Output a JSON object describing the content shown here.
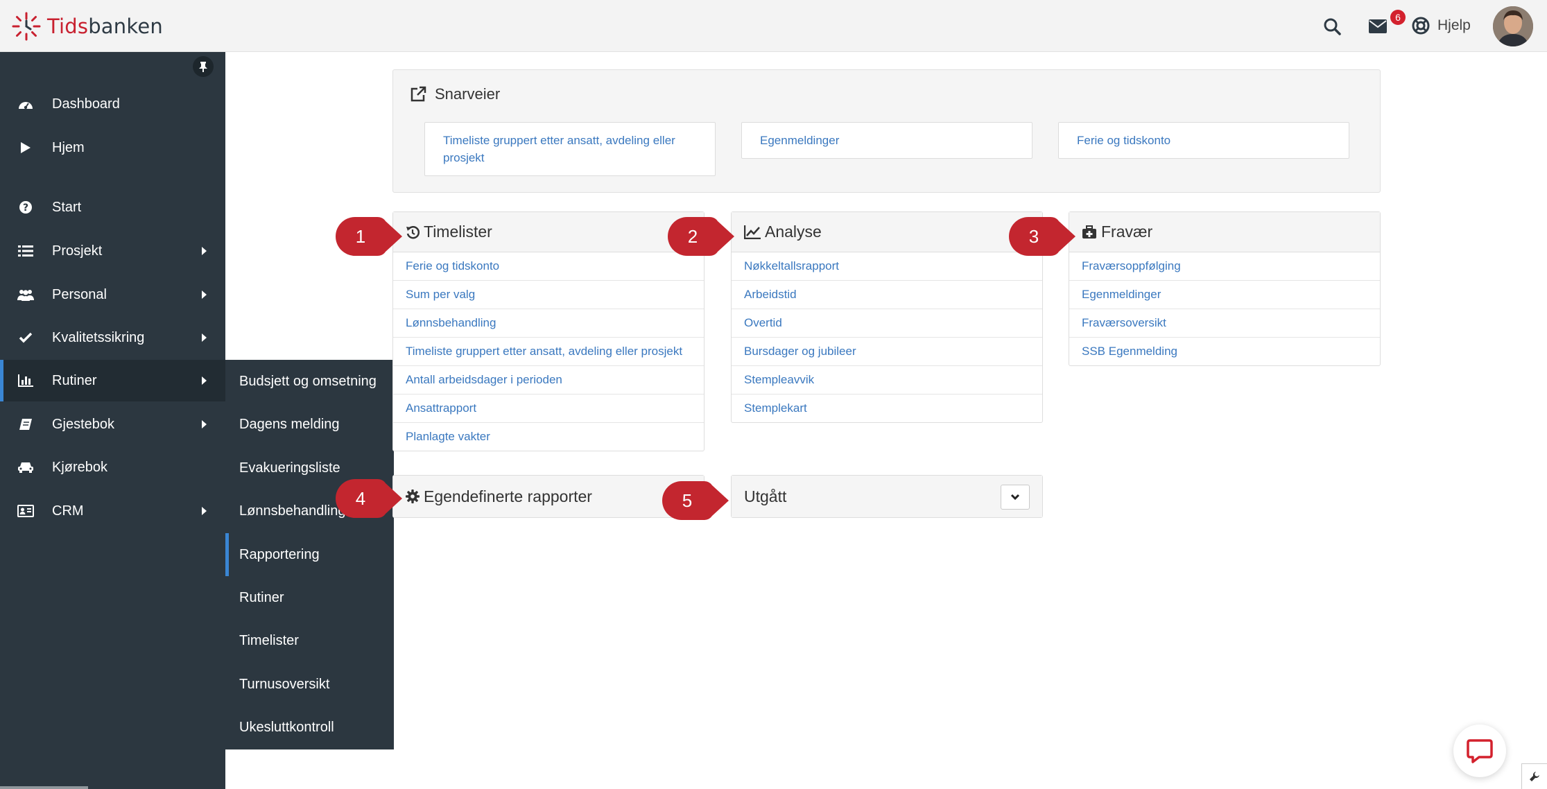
{
  "header": {
    "logo_part1": "Tids",
    "logo_part2": "banken",
    "mail_count": "6",
    "help_label": "Hjelp"
  },
  "sidebar": {
    "items": [
      {
        "label": "Dashboard",
        "icon": "dashboard-icon"
      },
      {
        "label": "Hjem",
        "icon": "play-icon"
      },
      {
        "label": "Start",
        "icon": "question-circle-icon"
      },
      {
        "label": "Prosjekt",
        "icon": "list-icon"
      },
      {
        "label": "Personal",
        "icon": "users-icon"
      },
      {
        "label": "Kvalitetssikring",
        "icon": "check-icon"
      },
      {
        "label": "Rutiner",
        "icon": "bar-chart-icon"
      },
      {
        "label": "Gjestebok",
        "icon": "book-icon"
      },
      {
        "label": "Kjørebok",
        "icon": "car-icon"
      },
      {
        "label": "CRM",
        "icon": "id-card-icon"
      }
    ]
  },
  "submenu": {
    "items": [
      "Budsjett og omsetning",
      "Dagens melding",
      "Evakueringsliste",
      "Lønnsbehandling",
      "Rapportering",
      "Rutiner",
      "Timelister",
      "Turnusoversikt",
      "Ukesluttkontroll"
    ]
  },
  "shortcuts": {
    "title": "Snarveier",
    "items": [
      "Timeliste gruppert etter ansatt, avdeling eller prosjekt",
      "Egenmeldinger",
      "Ferie og tidskonto"
    ]
  },
  "panels": {
    "timelister": {
      "title": "Timelister",
      "items": [
        "Ferie og tidskonto",
        "Sum per valg",
        "Lønnsbehandling",
        "Timeliste gruppert etter ansatt, avdeling eller prosjekt",
        "Antall arbeidsdager i perioden",
        "Ansattrapport",
        "Planlagte vakter"
      ]
    },
    "analyse": {
      "title": "Analyse",
      "items": [
        "Nøkkeltallsrapport",
        "Arbeidstid",
        "Overtid",
        "Bursdager og jubileer",
        "Stempleavvik",
        "Stemplekart"
      ]
    },
    "fravaer": {
      "title": "Fravær",
      "items": [
        "Fraværsoppfølging",
        "Egenmeldinger",
        "Fraværsoversikt",
        "SSB Egenmelding"
      ]
    },
    "egendefinerte": {
      "title": "Egendefinerte rapporter"
    },
    "utgatt": {
      "title": "Utgått"
    }
  },
  "markers": [
    "1",
    "2",
    "3",
    "4",
    "5"
  ],
  "colors": {
    "accent": "#3a86d4",
    "sidebar_bg": "#2c3740",
    "link": "#3a78bf",
    "marker": "#c3262f",
    "brand_red": "#c8202f"
  }
}
